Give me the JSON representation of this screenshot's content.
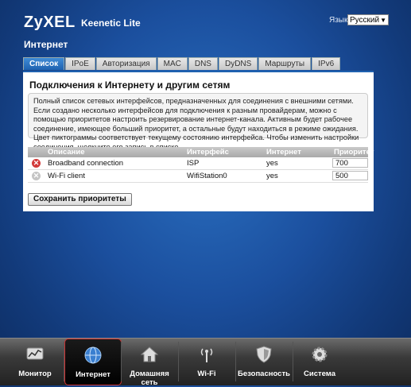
{
  "header": {
    "brand": "ZyXEL",
    "model": "Keenetic Lite",
    "language_label": "Язык:",
    "language_value": "Русский",
    "page_title": "Интернет"
  },
  "tabs": [
    {
      "label": "Список",
      "active": true
    },
    {
      "label": "IPoE"
    },
    {
      "label": "Авторизация"
    },
    {
      "label": "MAC"
    },
    {
      "label": "DNS"
    },
    {
      "label": "DyDNS"
    },
    {
      "label": "Маршруты"
    },
    {
      "label": "IPv6"
    }
  ],
  "panel": {
    "title": "Подключения к Интернету и другим сетям",
    "description": "Полный список сетевых интерфейсов, предназначенных для соединения с внешними сетями. Если создано несколько интерфейсов для подключения к разным провайдерам, можно с помощью приоритетов настроить резервирование интернет-канала. Активным будет рабочее соединение, имеющее больший приоритет, а остальные будут находиться в режиме ожидания. Цвет пиктограммы соответствует текущему состоянию интерфейса. Чтобы изменить настройки соединения, щелкните его запись в списке."
  },
  "table": {
    "headers": {
      "description": "Описание",
      "interface": "Интерфейс",
      "internet": "Интернет",
      "priority": "Приоритет"
    },
    "rows": [
      {
        "status": "error",
        "status_color": "#d23a3a",
        "description": "Broadband connection",
        "interface": "ISP",
        "internet": "yes",
        "priority": "700"
      },
      {
        "status": "inactive",
        "status_color": "#c4c4c4",
        "description": "Wi-Fi client",
        "interface": "WifiStation0",
        "internet": "yes",
        "priority": "500"
      }
    ]
  },
  "save_button": "Сохранить приоритеты",
  "bottom_nav": [
    {
      "label": "Монитор",
      "icon": "monitor-chart-icon"
    },
    {
      "label": "Интернет",
      "icon": "globe-icon",
      "active": true
    },
    {
      "label": "Домашняя сеть",
      "icon": "home-icon"
    },
    {
      "label": "Wi-Fi",
      "icon": "wifi-antenna-icon"
    },
    {
      "label": "Безопасность",
      "icon": "shield-icon"
    },
    {
      "label": "Система",
      "icon": "gear-icon"
    }
  ],
  "colors": {
    "accent": "#1f62b0",
    "active_border": "#cc3333",
    "error": "#d23a3a"
  }
}
